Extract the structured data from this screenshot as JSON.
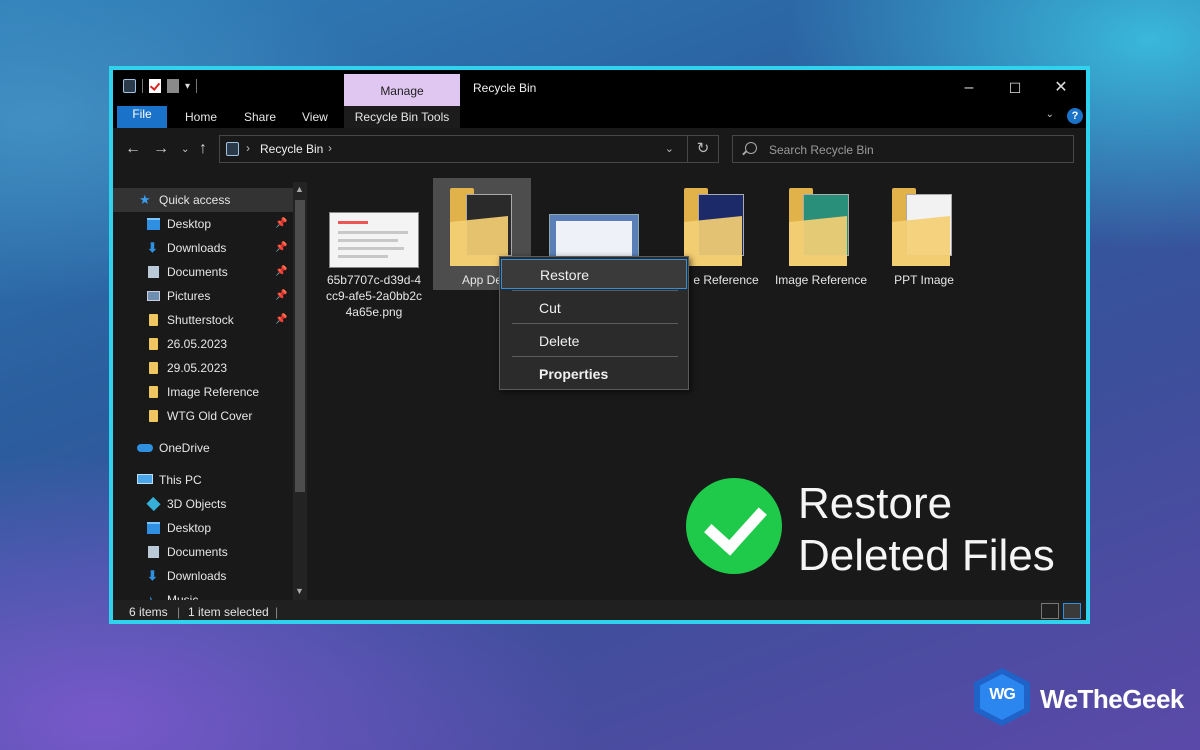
{
  "window": {
    "title": "Recycle Bin",
    "manage_tab": "Manage",
    "minimize": "–",
    "maximize": "☐",
    "close": "✕"
  },
  "ribbon": {
    "tabs": [
      "File",
      "Home",
      "Share",
      "View"
    ],
    "context_tab": "Recycle Bin Tools",
    "help": "?"
  },
  "address": {
    "path": "Recycle Bin",
    "search_placeholder": "Search Recycle Bin"
  },
  "nav": {
    "quick_access": "Quick access",
    "items": [
      "Desktop",
      "Downloads",
      "Documents",
      "Pictures",
      "Shutterstock",
      "26.05.2023",
      "29.05.2023",
      "Image Reference",
      "WTG Old Cover"
    ],
    "onedrive": "OneDrive",
    "this_pc": "This PC",
    "pc_items": [
      "3D Objects",
      "Desktop",
      "Documents",
      "Downloads",
      "Music"
    ]
  },
  "files": [
    {
      "name": "65b7707c-d39d-4cc9-afe5-2a0bb2c4a65e.png"
    },
    {
      "name": "App De"
    },
    {
      "name": ""
    },
    {
      "name": "e Reference"
    },
    {
      "name": "Image Reference"
    },
    {
      "name": "PPT Image"
    }
  ],
  "context_menu": [
    "Restore",
    "Cut",
    "Delete",
    "Properties"
  ],
  "status": {
    "count": "6 items",
    "selected": "1 item selected"
  },
  "promo": {
    "line1": "Restore",
    "line2": "Deleted Files"
  },
  "logo": {
    "monogram": "WG",
    "name": "WeTheGeek"
  },
  "colors": {
    "window_border": "#2fd3ee",
    "file_tab": "#1a73c8",
    "manage_tab": "#e0c7f1",
    "check_circle": "#1fca4a"
  }
}
